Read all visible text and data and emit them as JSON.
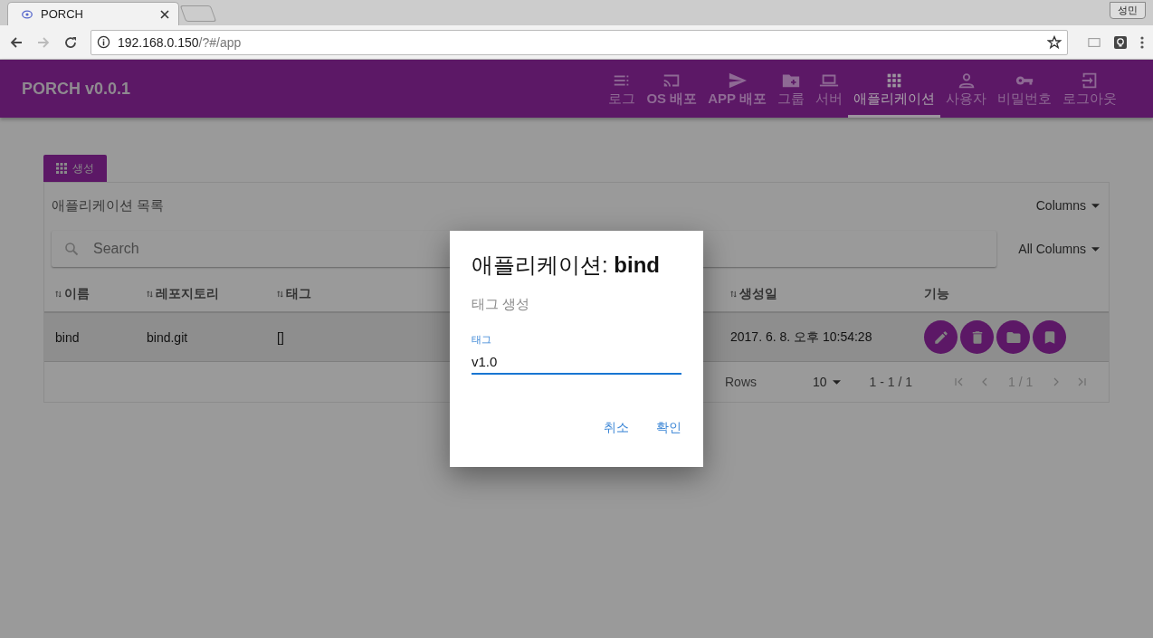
{
  "browser": {
    "tab_title": "PORCH",
    "profile": "성민",
    "url_host": "192.168.0.150",
    "url_path": "/?#/app"
  },
  "app": {
    "title": "PORCH v0.0.1",
    "nav": [
      {
        "kind": "log",
        "label": "로그",
        "selected": false,
        "bold": false
      },
      {
        "kind": "cast",
        "label": "OS 배포",
        "selected": false,
        "bold": true
      },
      {
        "kind": "send",
        "label": "APP 배포",
        "selected": false,
        "bold": true
      },
      {
        "kind": "folder-add",
        "label": "그룹",
        "selected": false,
        "bold": false
      },
      {
        "kind": "laptop",
        "label": "서버",
        "selected": false,
        "bold": false
      },
      {
        "kind": "apps",
        "label": "애플리케이션",
        "selected": true,
        "bold": false
      },
      {
        "kind": "person",
        "label": "사용자",
        "selected": false,
        "bold": false
      },
      {
        "kind": "key",
        "label": "비밀번호",
        "selected": false,
        "bold": false
      },
      {
        "kind": "logout",
        "label": "로그아웃",
        "selected": false,
        "bold": false
      }
    ]
  },
  "create_button": "생성",
  "list": {
    "title": "애플리케이션 목록",
    "columns_menu": "Columns",
    "search_placeholder": "Search",
    "search_scope": "All Columns",
    "columns": [
      {
        "label": "이름",
        "sortable": true
      },
      {
        "label": "레포지토리",
        "sortable": true
      },
      {
        "label": "태그",
        "sortable": true
      },
      {
        "label": "생성일",
        "sortable": true
      },
      {
        "label": "기능",
        "sortable": false
      }
    ],
    "rows": [
      {
        "cells": [
          "bind",
          "bind.git",
          "[]",
          "2017. 6. 8. 오후 10:54:28"
        ],
        "actions": [
          {
            "kind": "edit"
          },
          {
            "kind": "delete"
          },
          {
            "kind": "folder"
          },
          {
            "kind": "bookmark"
          }
        ]
      }
    ],
    "footer": {
      "rows_label": "Rows",
      "rows_per_page": "10",
      "range": "1 - 1 / 1",
      "page": "1 / 1"
    }
  },
  "dialog": {
    "title": "애플리케이션: **bind**",
    "subtitle": "태그 생성",
    "field_label": "태그",
    "field_value": "v1.0",
    "buttons": [
      "취소",
      "확인"
    ]
  }
}
